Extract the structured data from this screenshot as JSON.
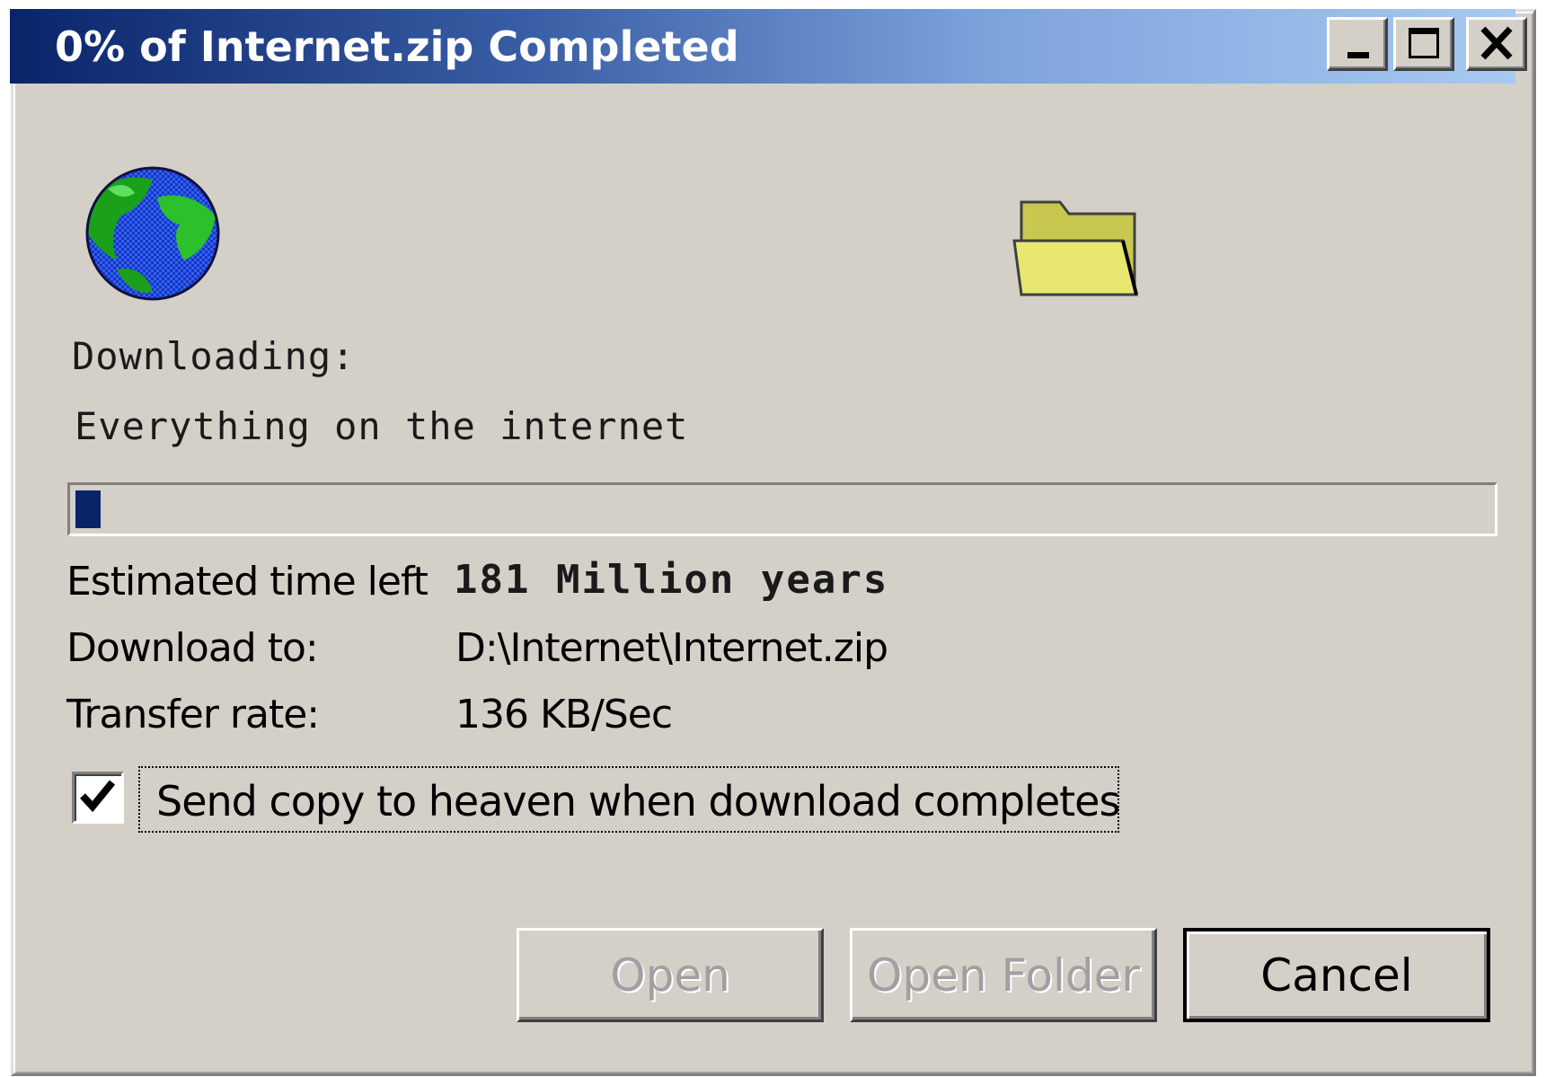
{
  "window": {
    "title": "0% of Internet.zip Completed",
    "controls": {
      "minimize": "minimize",
      "maximize": "maximize",
      "close": "close"
    }
  },
  "icons": {
    "source": "globe-icon",
    "destination": "folder-icon"
  },
  "download": {
    "heading": "Downloading:",
    "item": "Everything on the internet",
    "progress_fraction": 0.0
  },
  "details": {
    "time_label": "Estimated time left",
    "time_value": "181 Million years",
    "dest_label": "Download to:",
    "dest_value": "D:\\Internet\\Internet.zip",
    "rate_label": "Transfer rate:",
    "rate_value": "136 KB/Sec"
  },
  "option": {
    "checked": true,
    "label": "Send copy to heaven when download completes"
  },
  "buttons": {
    "open": "Open",
    "open_folder": "Open Folder",
    "cancel": "Cancel"
  },
  "colors": {
    "title_gradient_start": "#0a246a",
    "title_gradient_end": "#a6caf0",
    "face": "#d4d0c8",
    "progress": "#0a246a",
    "folder": "#e8e870"
  }
}
